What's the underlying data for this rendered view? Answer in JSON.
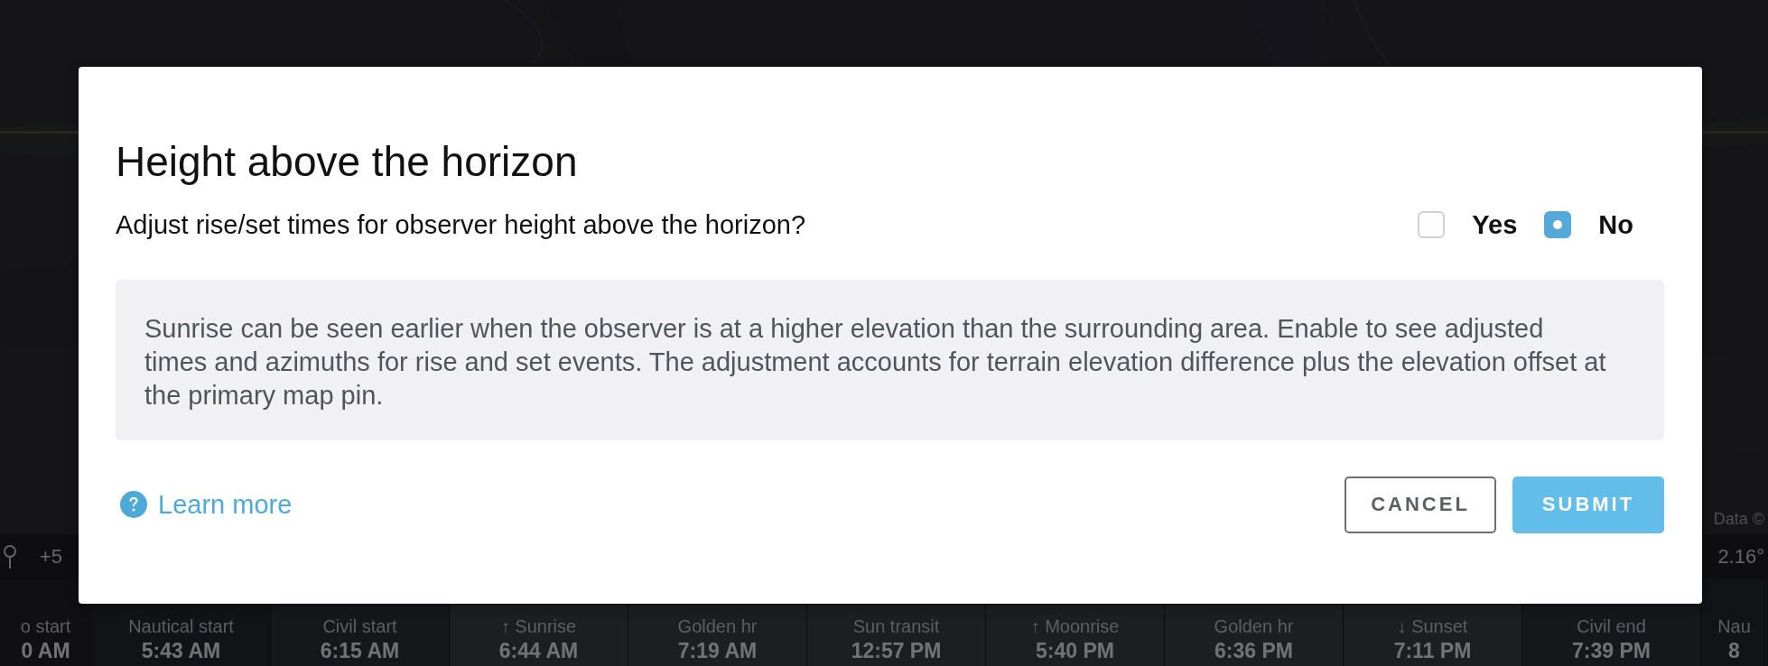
{
  "map": {
    "attribution": "Data ©"
  },
  "stats_bar": {
    "left": "+5",
    "right": "2.16°"
  },
  "timeline": [
    {
      "label": "o start",
      "time": "0 AM",
      "kind": "night"
    },
    {
      "label": "Nautical start",
      "time": "5:43 AM",
      "kind": "nautical"
    },
    {
      "label": "Civil start",
      "time": "6:15 AM",
      "kind": "civil"
    },
    {
      "label": "↑ Sunrise",
      "time": "6:44 AM",
      "kind": "day"
    },
    {
      "label": "Golden hr",
      "time": "7:19 AM",
      "kind": "day"
    },
    {
      "label": "Sun transit",
      "time": "12:57 PM",
      "kind": "day"
    },
    {
      "label": "↑ Moonrise",
      "time": "5:40 PM",
      "kind": "day"
    },
    {
      "label": "Golden hr",
      "time": "6:36 PM",
      "kind": "day"
    },
    {
      "label": "↓ Sunset",
      "time": "7:11 PM",
      "kind": "day"
    },
    {
      "label": "Civil end",
      "time": "7:39 PM",
      "kind": "civil"
    },
    {
      "label": "Nau",
      "time": "8",
      "kind": "nautical"
    }
  ],
  "dialog": {
    "title": "Height above the horizon",
    "question": "Adjust rise/set times for observer height above the horizon?",
    "options": [
      {
        "label": "Yes",
        "selected": false
      },
      {
        "label": "No",
        "selected": true
      }
    ],
    "info": "Sunrise can be seen earlier when the observer is at a higher elevation than the surrounding area. Enable to see adjusted times and azimuths for rise and set events. The adjustment accounts for terrain elevation difference plus the elevation offset at the primary map pin.",
    "learn_more": "Learn more",
    "buttons": [
      {
        "label": "CANCEL",
        "kind": "secondary"
      },
      {
        "label": "SUBMIT",
        "kind": "primary"
      }
    ]
  }
}
